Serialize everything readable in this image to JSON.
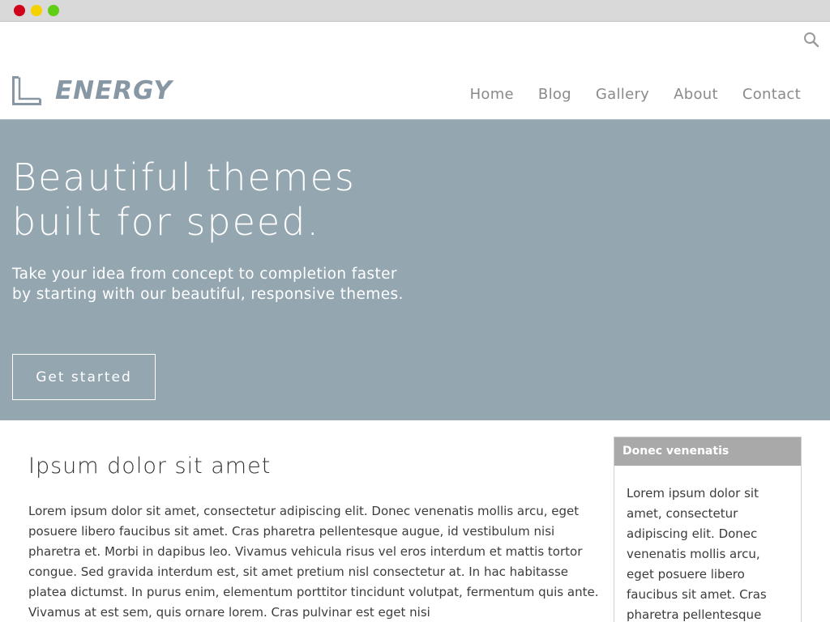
{
  "window": {
    "controls": [
      "close",
      "minimize",
      "maximize"
    ]
  },
  "header": {
    "search_icon": "search-icon",
    "logo_text": "ENERGY",
    "nav": [
      {
        "label": "Home"
      },
      {
        "label": "Blog"
      },
      {
        "label": "Gallery"
      },
      {
        "label": "About"
      },
      {
        "label": "Contact"
      }
    ]
  },
  "hero": {
    "title_line1": "Beautiful themes",
    "title_line2": "built for speed.",
    "subtitle": "Take your idea from concept to completion faster by starting with our beautiful, responsive themes.",
    "button_label": "Get started",
    "background_color": "#94a6b0"
  },
  "main": {
    "title": "Ipsum dolor sit amet",
    "body": "Lorem ipsum dolor sit amet, consectetur adipiscing elit. Donec venenatis mollis arcu, eget posuere libero faucibus sit amet. Cras pharetra pellentesque augue, id vestibulum nisi pharetra et. Morbi in dapibus leo. Vivamus vehicula risus vel eros interdum et mattis tortor congue. Sed gravida interdum est, sit amet pretium nisl consectetur at. In hac habitasse platea dictumst. In purus enim, elementum porttitor tincidunt volutpat, fermentum quis ante. Vivamus at est sem, quis ornare lorem. Cras pulvinar est eget nisi"
  },
  "sidebar": {
    "heading": "Donec venenatis",
    "body": "Lorem ipsum dolor sit amet, consectetur adipiscing elit. Donec venenatis mollis arcu, eget posuere libero faucibus sit amet. Cras pharetra pellentesque augue, id"
  }
}
